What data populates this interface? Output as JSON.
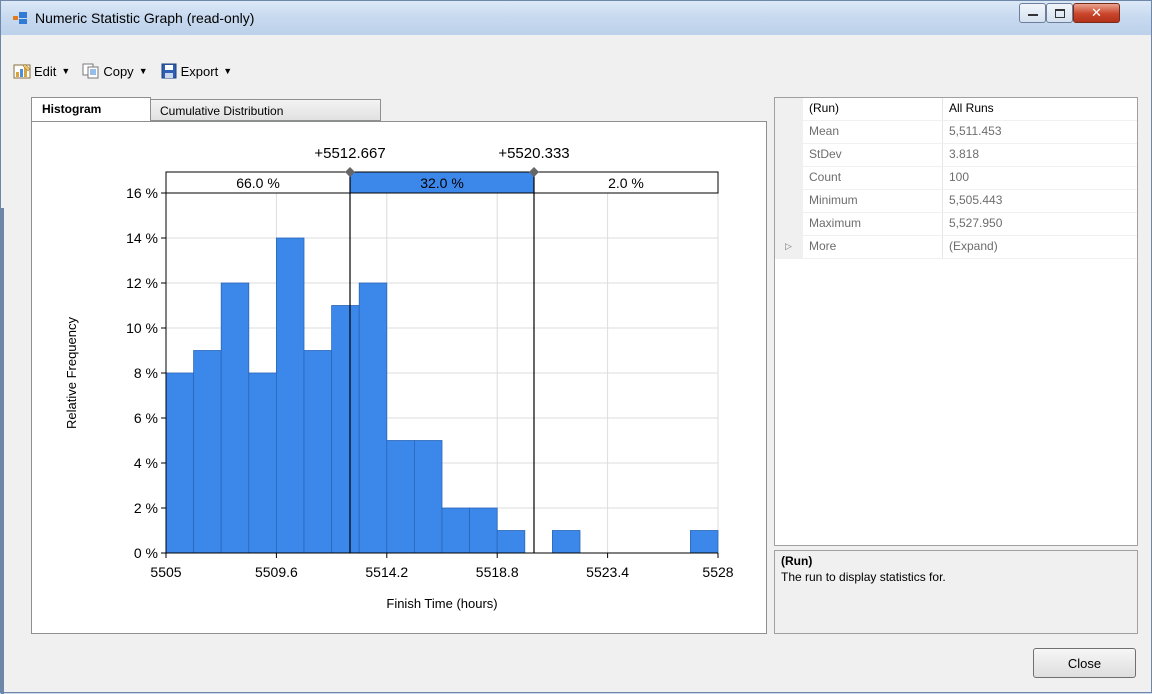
{
  "window": {
    "title": "Numeric Statistic Graph (read-only)"
  },
  "toolbar": {
    "edit_label": "Edit",
    "copy_label": "Copy",
    "export_label": "Export"
  },
  "tabs": {
    "histogram": "Histogram",
    "cumulative": "Cumulative Distribution"
  },
  "chart_data": {
    "type": "bar",
    "xlabel": "Finish Time (hours)",
    "ylabel": "Relative Frequency",
    "xlim": [
      5505,
      5528
    ],
    "ylim": [
      0,
      16
    ],
    "x_ticks": [
      "5505",
      "5509.6",
      "5514.2",
      "5518.8",
      "5523.4",
      "5528"
    ],
    "y_ticks": [
      "0 %",
      "2 %",
      "4 %",
      "6 %",
      "8 %",
      "10 %",
      "12 %",
      "14 %",
      "16 %"
    ],
    "bin_start": 5505,
    "bin_width": 1.15,
    "values": [
      8,
      9,
      12,
      8,
      14,
      9,
      11,
      12,
      5,
      5,
      2,
      2,
      1,
      0,
      1,
      0,
      0,
      0,
      0,
      1
    ],
    "markers": [
      {
        "value": 5512.667,
        "label": "+5512.667"
      },
      {
        "value": 5520.333,
        "label": "+5520.333"
      }
    ],
    "regions": [
      {
        "label": "66.0 %",
        "highlighted": false
      },
      {
        "label": "32.0 %",
        "highlighted": true
      },
      {
        "label": "2.0 %",
        "highlighted": false
      }
    ],
    "bar_color": "#3b87ea",
    "bar_edge_color": "#2a67b8",
    "highlight_color": "#3b87ea"
  },
  "properties": {
    "rows": [
      {
        "name": "(Run)",
        "value": "All Runs",
        "style": "head"
      },
      {
        "name": "Mean",
        "value": "5,511.453",
        "style": "dim"
      },
      {
        "name": "StDev",
        "value": "3.818",
        "style": "dim"
      },
      {
        "name": "Count",
        "value": "100",
        "style": "dim"
      },
      {
        "name": "Minimum",
        "value": "5,505.443",
        "style": "dim"
      },
      {
        "name": "Maximum",
        "value": "5,527.950",
        "style": "dim"
      },
      {
        "name": "More",
        "value": "(Expand)",
        "style": "dim",
        "expandable": true
      }
    ]
  },
  "description": {
    "title": "(Run)",
    "text": "The run to display statistics for."
  },
  "buttons": {
    "close": "Close"
  }
}
